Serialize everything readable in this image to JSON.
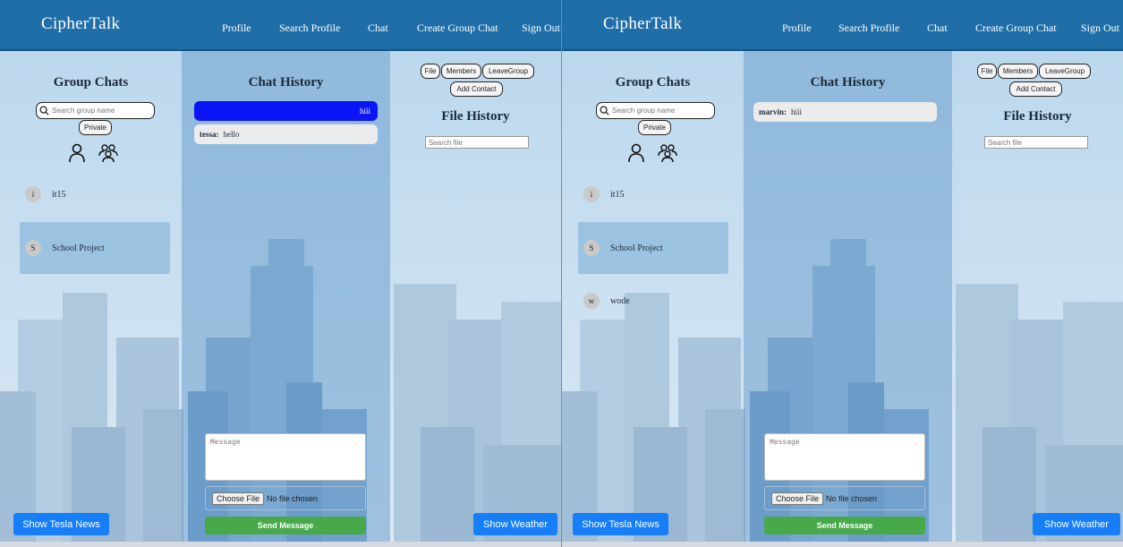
{
  "nav": {
    "brand": "CipherTalk",
    "items": [
      "Profile",
      "Search Profile",
      "Chat",
      "Create Group Chat",
      "Sign Out"
    ]
  },
  "sidebar": {
    "title": "Group Chats",
    "search_placeholder": "Search group name",
    "private_label": "Private"
  },
  "chat": {
    "title": "Chat History",
    "message_placeholder": "Message",
    "choose_file_label": "Choose File",
    "no_file_text": "No file chosen",
    "send_label": "Send Message"
  },
  "files": {
    "title": "File History",
    "search_placeholder": "Search file",
    "buttons": [
      "File",
      "Members",
      "LeaveGroup",
      "Add Contact"
    ]
  },
  "buttons": {
    "news": "Show Tesla News",
    "weather": "Show Weather"
  },
  "left_window": {
    "groups": [
      {
        "initial": "i",
        "name": "it15"
      },
      {
        "initial": "S",
        "name": "School Project"
      }
    ],
    "messages": [
      {
        "text": "hiii"
      },
      {
        "sender": "tessa:",
        "text": "hello"
      }
    ]
  },
  "right_window": {
    "groups": [
      {
        "initial": "i",
        "name": "it15"
      },
      {
        "initial": "S",
        "name": "School Project"
      },
      {
        "initial": "w",
        "name": "wode"
      }
    ],
    "messages": [
      {
        "sender": "marvin:",
        "text": "hiii"
      }
    ]
  },
  "colors": {
    "navbar": "#1f6ea8",
    "sent_bubble": "#0a14f5",
    "send_button": "#47a94a",
    "action_button": "#157ef8"
  }
}
